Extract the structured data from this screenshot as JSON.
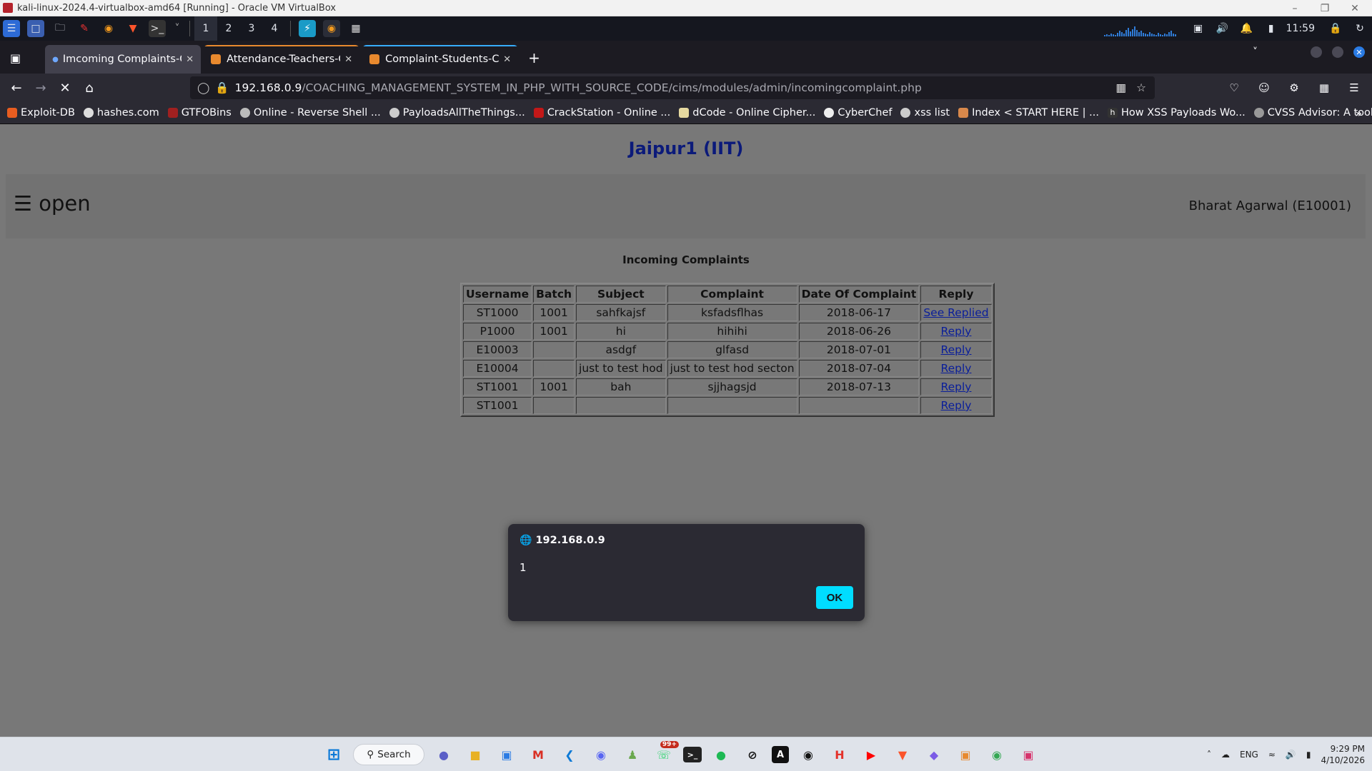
{
  "vbox": {
    "title": "kali-linux-2024.4-virtualbox-amd64 [Running] - Oracle VM VirtualBox"
  },
  "kali_panel": {
    "workspaces": [
      "1",
      "2",
      "3",
      "4"
    ],
    "time": "11:59"
  },
  "tabs": [
    {
      "title": "Imcoming Complaints-CIMS",
      "active": true
    },
    {
      "title": "Attendance-Teachers-CIMS",
      "active": false
    },
    {
      "title": "Complaint-Students-CIMS",
      "active": false
    }
  ],
  "url": {
    "host": "192.168.0.9",
    "path": "/COACHING_MANAGEMENT_SYSTEM_IN_PHP_WITH_SOURCE_CODE/cims/modules/admin/incomingcomplaint.php"
  },
  "bookmarks": [
    "Exploit-DB",
    "hashes.com",
    "GTFOBins",
    "Online - Reverse Shell ...",
    "PayloadsAllTheThings...",
    "CrackStation - Online ...",
    "dCode - Online Cipher...",
    "CyberChef",
    "xss list",
    "Index < START HERE | ...",
    "How XSS Payloads Wo...",
    "CVSS Advisor: A tool t..."
  ],
  "page": {
    "site_title": "Jaipur1 (IIT)",
    "menu_label": "☰ open",
    "user": "Bharat Agarwal (E10001)",
    "section_title": "Incoming Complaints",
    "table": {
      "headers": [
        "Username",
        "Batch",
        "Subject",
        "Complaint",
        "Date Of Complaint",
        "Reply"
      ],
      "rows": [
        [
          "ST1000",
          "1001",
          "sahfkajsf",
          "ksfadsflhas",
          "2018-06-17",
          "See Replied"
        ],
        [
          "P1000",
          "1001",
          "hi",
          "hihihi",
          "2018-06-26",
          "Reply"
        ],
        [
          "E10003",
          "",
          "asdgf",
          "glfasd",
          "2018-07-01",
          "Reply"
        ],
        [
          "E10004",
          "",
          "just to test hod",
          "just to test hod secton",
          "2018-07-04",
          "Reply"
        ],
        [
          "ST1001",
          "1001",
          "bah",
          "sjjhagsjd",
          "2018-07-13",
          "Reply"
        ],
        [
          "ST1001",
          "",
          "",
          "",
          "",
          "Reply"
        ]
      ]
    }
  },
  "alert": {
    "origin": "192.168.0.9",
    "message": "1",
    "ok_label": "OK"
  },
  "taskbar": {
    "search_label": "Search",
    "lang": "ENG",
    "time": "9:29 PM",
    "date": "4/10/2026",
    "whatsapp_badge": "99+"
  },
  "colors": {
    "content_bg": "#787878",
    "title_blue": "#0b1a7a",
    "link": "#0a1e9a",
    "alert_ok": "#00ddff"
  }
}
